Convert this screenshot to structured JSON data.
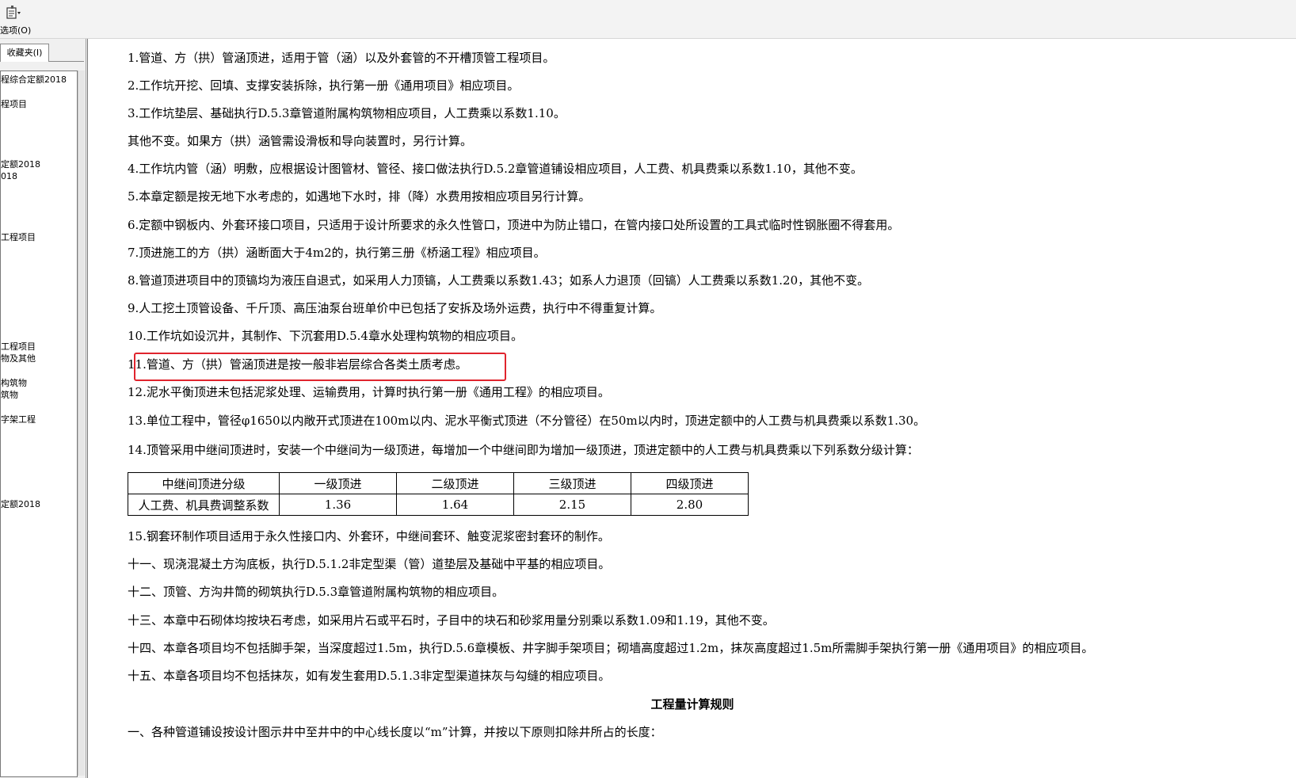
{
  "toolbar": {
    "options_label": "选项(O)"
  },
  "left_pane": {
    "tab_label": "收藏夹(I)",
    "tree_items": [
      {
        "label": "程综合定额2018"
      },
      {
        "label": "程项目"
      },
      {
        "label": "定额2018"
      },
      {
        "label": "018"
      },
      {
        "label": "工程项目"
      },
      {
        "label": "工程项目"
      },
      {
        "label": "物及其他"
      },
      {
        "label": "构筑物"
      },
      {
        "label": "筑物"
      },
      {
        "label": "字架工程"
      },
      {
        "label": "定额2018"
      }
    ]
  },
  "content": {
    "lines": [
      "1.管道、方（拱）管涵顶进，适用于管（涵）以及外套管的不开槽顶管工程项目。",
      "2.工作坑开挖、回填、支撑安装拆除，执行第一册《通用项目》相应项目。",
      "3.工作坑垫层、基础执行D.5.3章管道附属构筑物相应项目，人工费乘以系数1.10。",
      "其他不变。如果方（拱）涵管需设滑板和导向装置时，另行计算。",
      "4.工作坑内管（涵）明敷，应根据设计图管材、管径、接口做法执行D.5.2章管道铺设相应项目，人工费、机具费乘以系数1.10，其他不变。",
      "5.本章定额是按无地下水考虑的，如遇地下水时，排（降）水费用按相应项目另行计算。",
      "6.定额中钢板内、外套环接口项目，只适用于设计所要求的永久性管口，顶进中为防止错口，在管内接口处所设置的工具式临时性钢胀圈不得套用。",
      "7.顶进施工的方（拱）涵断面大于4m2的，执行第三册《桥涵工程》相应项目。",
      "8.管道顶进项目中的顶镐均为液压自退式，如采用人力顶镐，人工费乘以系数1.43；如系人力退顶（回镐）人工费乘以系数1.20，其他不变。",
      "9.人工挖土顶管设备、千斤顶、高压油泵台班单价中已包括了安拆及场外运费，执行中不得重复计算。",
      "10.工作坑如设沉井，其制作、下沉套用D.5.4章水处理构筑物的相应项目。",
      "11.管道、方（拱）管涵顶进是按一般非岩层综合各类土质考虑。",
      "12.泥水平衡顶进未包括泥浆处理、运输费用，计算时执行第一册《通用工程》的相应项目。",
      "13.单位工程中，管径φ1650以内敞开式顶进在100m以内、泥水平衡式顶进（不分管径）在50m以内时，顶进定额中的人工费与机具费乘以系数1.30。",
      "14.顶管采用中继间顶进时，安装一个中继间为一级顶进，每增加一个中继间即为增加一级顶进，顶进定额中的人工费与机具费乘以下列系数分级计算："
    ],
    "table": {
      "header": [
        "中继间顶进分级",
        "一级顶进",
        "二级顶进",
        "三级顶进",
        "四级顶进"
      ],
      "row": [
        "人工费、机具费调整系数",
        "1.36",
        "1.64",
        "2.15",
        "2.80"
      ]
    },
    "lines_after": [
      "15.钢套环制作项目适用于永久性接口内、外套环，中继间套环、触变泥浆密封套环的制作。",
      "十一、现浇混凝土方沟底板，执行D.5.1.2非定型渠（管）道垫层及基础中平基的相应项目。",
      "十二、顶管、方沟井筒的砌筑执行D.5.3章管道附属构筑物的相应项目。",
      "十三、本章中石砌体均按块石考虑，如采用片石或平石时，子目中的块石和砂浆用量分别乘以系数1.09和1.19，其他不变。",
      "十四、本章各项目均不包括脚手架，当深度超过1.5m，执行D.5.6章模板、井字脚手架项目；砌墙高度超过1.2m，抹灰高度超过1.5m所需脚手架执行第一册《通用项目》的相应项目。",
      "十五、本章各项目均不包括抹灰，如有发生套用D.5.1.3非定型渠道抹灰与勾缝的相应项目。"
    ],
    "heading": "工程量计算规则",
    "last_line": "一、各种管道铺设按设计图示井中至井中的中心线长度以“m”计算，并按以下原则扣除井所占的长度："
  }
}
